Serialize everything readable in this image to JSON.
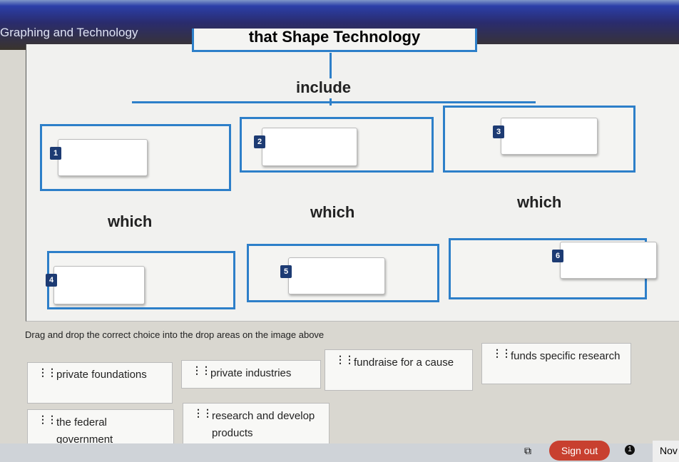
{
  "header": {
    "title": "Graphing and Technology"
  },
  "diagram": {
    "top": "that Shape Technology",
    "include": "include",
    "which": [
      "which",
      "which",
      "which"
    ],
    "drop_numbers": [
      "1",
      "2",
      "3",
      "4",
      "5",
      "6"
    ]
  },
  "instructions": "Drag and drop the correct choice into the drop areas on the image above",
  "choices": [
    "private foundations",
    "private industries",
    "fundraise for a cause",
    "funds specific research",
    "the federal government",
    "research and develop products"
  ],
  "footer": {
    "sign_out": "Sign out",
    "notifications": "1",
    "date": "Nov"
  },
  "colors": {
    "accent": "#2d7fc9",
    "sign_out": "#c8402f"
  }
}
